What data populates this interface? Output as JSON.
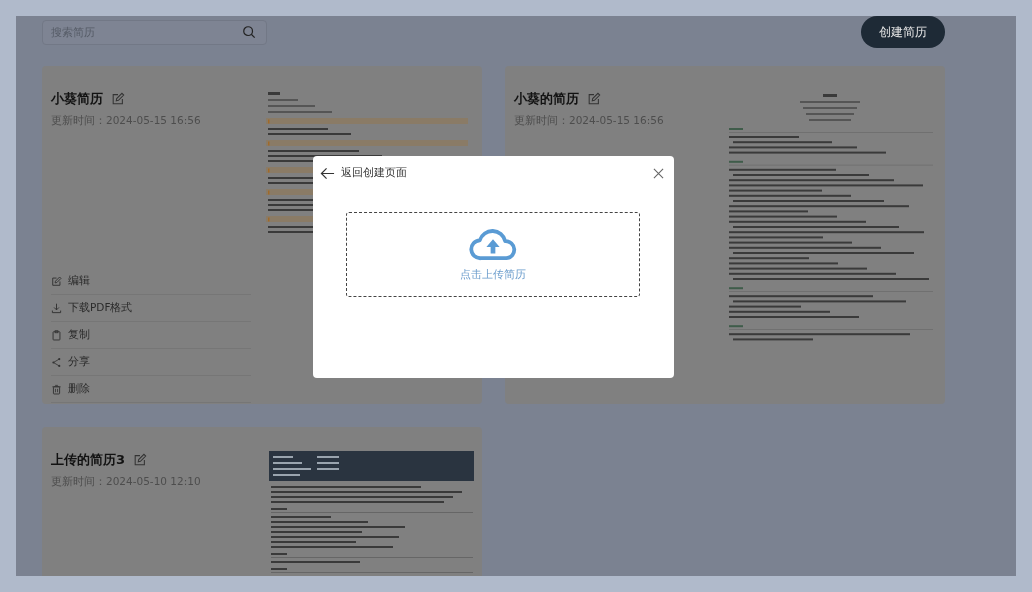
{
  "search": {
    "placeholder": "搜索简历"
  },
  "create_button": {
    "label": "创建简历"
  },
  "cards": [
    {
      "kind": "classic",
      "title": "小葵简历",
      "updated": "更新时间：2024-05-15 16:56",
      "actions": [
        {
          "kind": "edit",
          "label": "编辑"
        },
        {
          "kind": "download",
          "label": "下载PDF格式"
        },
        {
          "kind": "copy",
          "label": "复制"
        },
        {
          "kind": "share",
          "label": "分享"
        },
        {
          "kind": "delete",
          "label": "删除"
        }
      ]
    },
    {
      "kind": "centered",
      "title": "小葵的简历",
      "updated": "更新时间：2024-05-15 16:56"
    },
    {
      "kind": "dark-header",
      "title": "上传的简历3",
      "updated": "更新时间：2024-05-10 12:10"
    }
  ],
  "dialog": {
    "back_label": "返回创建页面",
    "upload_label": "点击上传简历"
  }
}
